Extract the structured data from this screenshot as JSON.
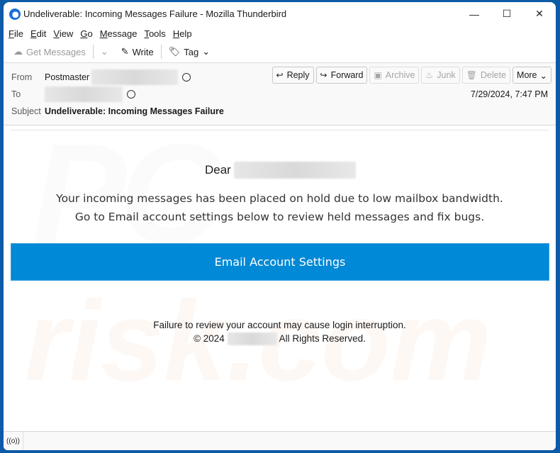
{
  "window": {
    "title": "Undeliverable: Incoming Messages Failure - Mozilla Thunderbird",
    "controls": {
      "minimize": "—",
      "maximize": "☐",
      "close": "✕"
    }
  },
  "menu": [
    {
      "label": "File",
      "mnemonic": "F",
      "rest": "ile"
    },
    {
      "label": "Edit",
      "mnemonic": "E",
      "rest": "dit"
    },
    {
      "label": "View",
      "mnemonic": "V",
      "rest": "iew"
    },
    {
      "label": "Go",
      "mnemonic": "G",
      "rest": "o"
    },
    {
      "label": "Message",
      "mnemonic": "M",
      "rest": "essage"
    },
    {
      "label": "Tools",
      "mnemonic": "T",
      "rest": "ools"
    },
    {
      "label": "Help",
      "mnemonic": "H",
      "rest": "elp"
    }
  ],
  "toolbar": {
    "get_messages": "Get Messages",
    "write": "Write",
    "tag": "Tag"
  },
  "header": {
    "from_label": "From",
    "from_name": "Postmaster",
    "to_label": "To",
    "subject_label": "Subject",
    "subject": "Undeliverable: Incoming Messages Failure",
    "date": "7/29/2024, 7:47 PM",
    "actions": {
      "reply": "Reply",
      "forward": "Forward",
      "archive": "Archive",
      "junk": "Junk",
      "delete": "Delete",
      "more": "More"
    }
  },
  "message": {
    "greeting": "Dear",
    "line1": "Your incoming messages has been placed on hold due to low mailbox bandwidth.",
    "line2": "Go to Email account settings below to review held messages and fix bugs.",
    "button": "Email Account Settings",
    "warning": "Failure to review your account may cause login interruption.",
    "copyright_prefix": "© 2024",
    "copyright_suffix": "All Rights Reserved.",
    "button_color": "#0089d6"
  },
  "watermark": {
    "top": "PC",
    "bottom": "risk.com"
  }
}
